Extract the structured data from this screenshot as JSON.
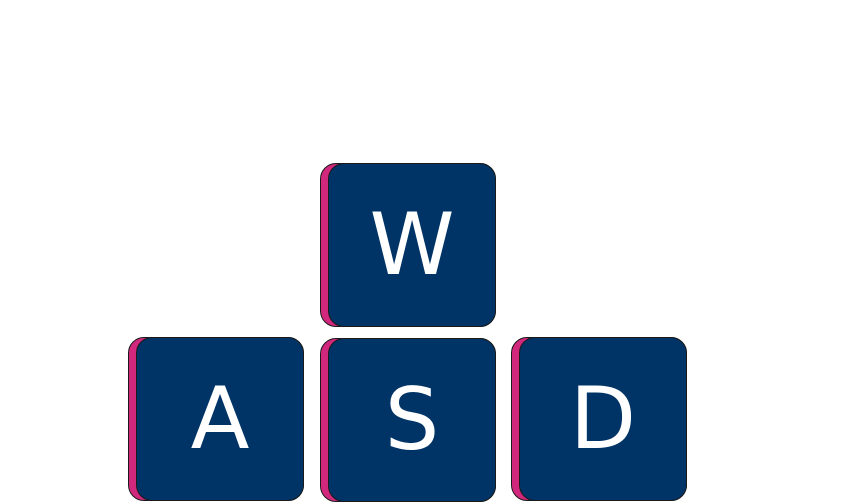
{
  "colors": {
    "background": "#ffffff",
    "key_face": "#003366",
    "key_shadow": "#d1277d",
    "key_border": "#1a1a1a",
    "key_text": "#ffffff"
  },
  "keys": [
    {
      "label": "W"
    },
    {
      "label": "A"
    },
    {
      "label": "S"
    },
    {
      "label": "D"
    }
  ]
}
